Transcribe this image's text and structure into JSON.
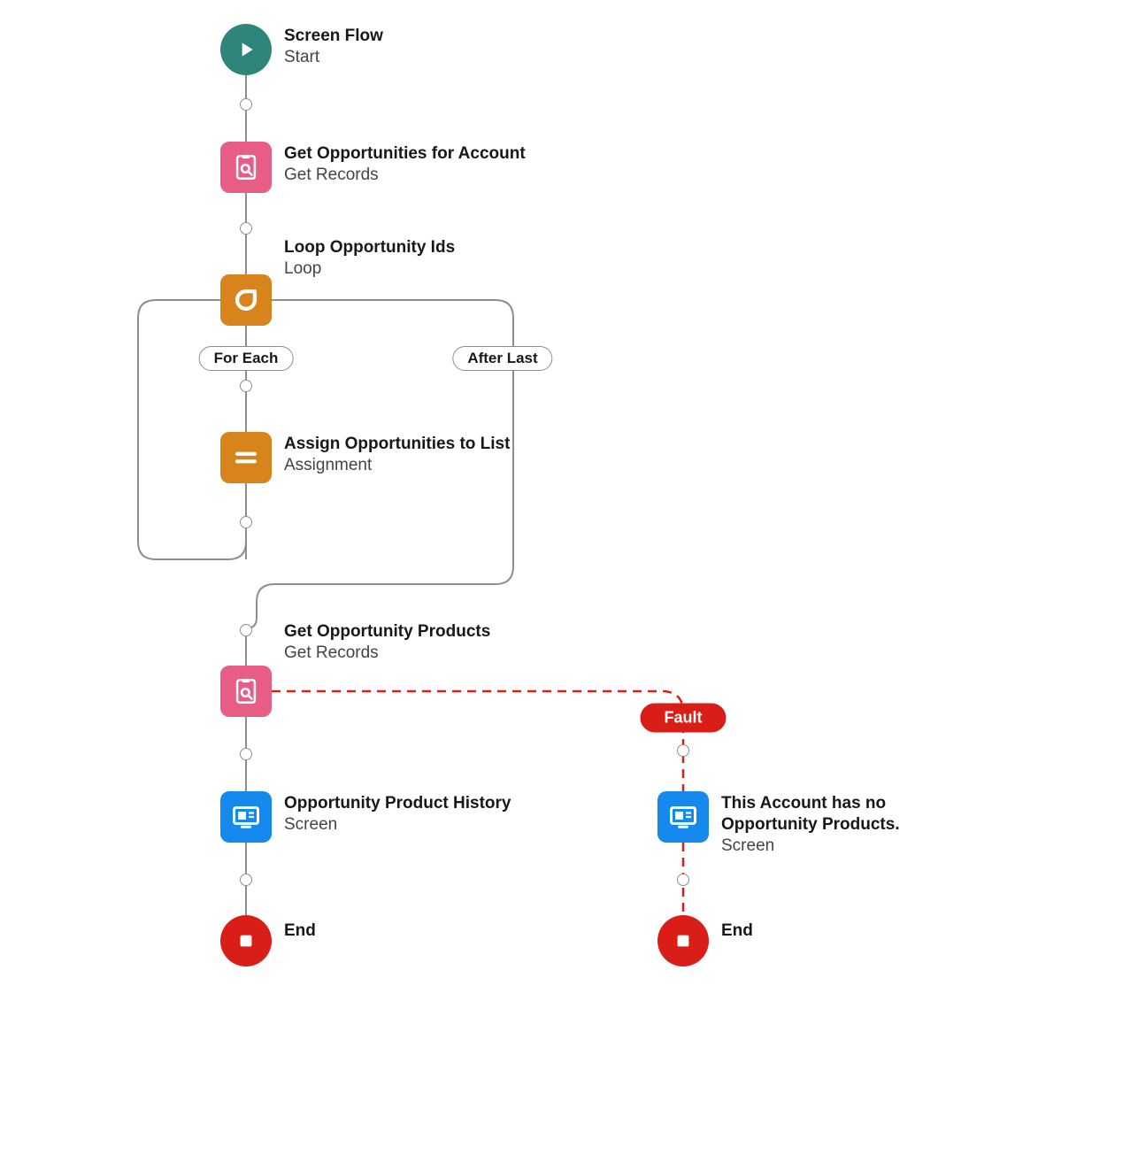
{
  "colors": {
    "start": "#2e8579",
    "get_records": "#e85d86",
    "loop": "#d8841d",
    "assignment": "#d8841d",
    "screen": "#1589ee",
    "end": "#d91e18",
    "connector": "#8e8e8e",
    "fault": "#d91e18"
  },
  "nodes": {
    "start": {
      "title": "Screen Flow",
      "subtitle": "Start"
    },
    "get_opportunities": {
      "title": "Get Opportunities for Account",
      "subtitle": "Get Records"
    },
    "loop": {
      "title": "Loop Opportunity Ids",
      "subtitle": "Loop"
    },
    "assign": {
      "title": "Assign Opportunities to List",
      "subtitle": "Assignment"
    },
    "get_products": {
      "title": "Get Opportunity Products",
      "subtitle": "Get Records"
    },
    "screen_history": {
      "title": "Opportunity Product History",
      "subtitle": "Screen"
    },
    "screen_no_products": {
      "title": "This Account has no Opportunity Products.",
      "subtitle": "Screen"
    },
    "end_left": {
      "title": "End"
    },
    "end_right": {
      "title": "End"
    }
  },
  "badges": {
    "for_each": "For Each",
    "after_last": "After Last",
    "fault": "Fault"
  }
}
